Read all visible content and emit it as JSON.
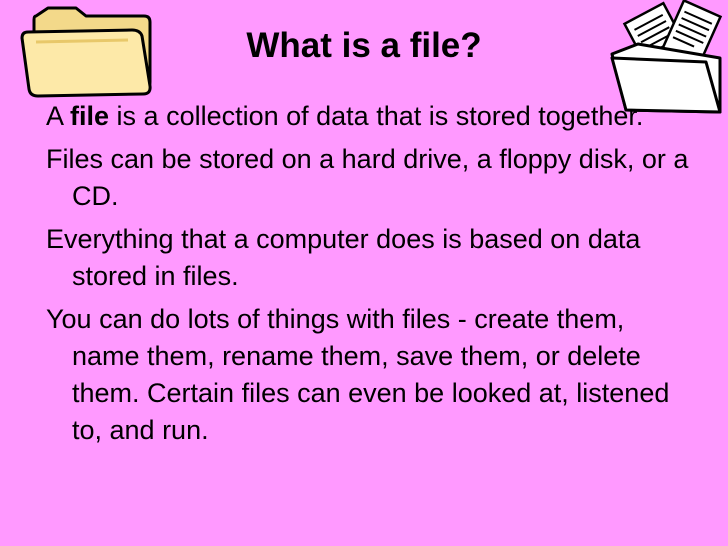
{
  "slide": {
    "background": "#ff99ff",
    "title": "What is a file?",
    "icons": {
      "left": "open-folder-icon",
      "right": "folder-with-papers-icon"
    },
    "bullets": [
      {
        "prefix": "A ",
        "bold": "file",
        "suffix": " is a collection of data that is stored together."
      },
      {
        "text": "Files can be stored on a hard drive, a floppy disk, or a CD."
      },
      {
        "text": "Everything that a computer does is based on data stored in files."
      },
      {
        "text": "You can do lots of things with files - create them, name them, rename them, save them, or delete them. Certain files can even be looked at, listened to, and run."
      }
    ]
  }
}
